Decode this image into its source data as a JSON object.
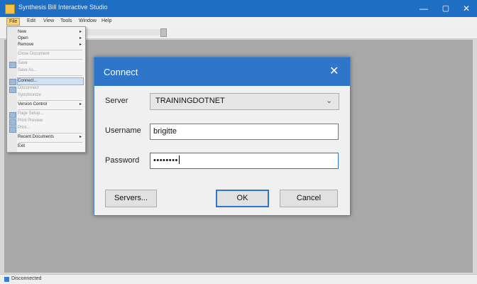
{
  "window": {
    "title": "Synthesis Bill Interactive Studio",
    "controls": {
      "minimize": "—",
      "maximize": "▢",
      "close": "✕"
    }
  },
  "menubar": [
    "File",
    "Edit",
    "View",
    "Tools",
    "Window",
    "Help"
  ],
  "file_menu": {
    "items": [
      {
        "label": "New",
        "arrow": "▸",
        "disabled": false
      },
      {
        "label": "Open",
        "arrow": "▸",
        "disabled": false
      },
      {
        "label": "Remove",
        "arrow": "▸",
        "disabled": false
      },
      {
        "label": "Close Document",
        "disabled": true
      },
      {
        "label": "Save",
        "disabled": true
      },
      {
        "label": "Save As...",
        "disabled": true
      },
      {
        "label": "Connect...",
        "disabled": false,
        "selected": true
      },
      {
        "label": "Disconnect",
        "disabled": true
      },
      {
        "label": "Synchronize",
        "disabled": true
      },
      {
        "label": "Version Control",
        "arrow": "▸",
        "disabled": false
      },
      {
        "label": "Page Setup...",
        "disabled": true
      },
      {
        "label": "Print Preview",
        "disabled": true
      },
      {
        "label": "Print...",
        "disabled": true
      },
      {
        "label": "Recent Documents",
        "arrow": "▸",
        "disabled": false
      },
      {
        "label": "Exit",
        "disabled": false
      }
    ]
  },
  "status": {
    "text": "Disconnected"
  },
  "dialog": {
    "title": "Connect",
    "close": "✕",
    "server_label": "Server",
    "server_value": "TRAININGDOTNET",
    "username_label": "Username",
    "username_value": "brigitte",
    "password_label": "Password",
    "password_mask": "••••••••",
    "servers_button": "Servers...",
    "ok_button": "OK",
    "cancel_button": "Cancel"
  },
  "icons": {
    "app": "app-icon",
    "dropdown": "chevron-down-icon",
    "close": "close-icon"
  },
  "colors": {
    "titlebar": "#1e6fc4",
    "dialog_titlebar": "#2f75c9",
    "client_area": "#a8a8a8",
    "menu_highlight": "#f7d37a"
  }
}
